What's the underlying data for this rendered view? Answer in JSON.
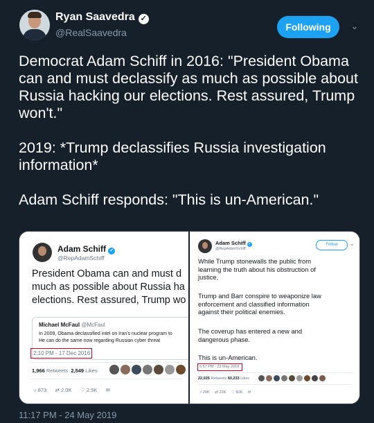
{
  "tweet": {
    "author_name": "Ryan Saavedra",
    "author_handle": "@RealSaavedra",
    "verified_glyph": "✓",
    "follow_label": "Following",
    "caret_glyph": "⌄",
    "paragraphs": [
      "Democrat Adam Schiff in 2016: \"President Obama can and must declassify as much as possible about Russia hacking our elections. Rest assured, Trump won't.\"",
      "2019: *Trump declassifies Russia investigation information*",
      "Adam Schiff responds: \"This is un-American.\""
    ],
    "timestamp": "11:17 PM - 24 May 2019"
  },
  "left_image": {
    "name": "Adam Schiff",
    "handle": "@RepAdamSchiff",
    "text_lines": [
      "President Obama can and must d",
      "much as possible about Russia ha",
      "elections. Rest assured, Trump wo"
    ],
    "quote_name": "Michael McFaul",
    "quote_handle": "@McFaul",
    "quote_lines": [
      "In 2009, Obama declassified intel on Iran's nuclear program  to",
      "He can do the same now regarding Russian cyber threat"
    ],
    "timestamp": "2:10 PM - 17 Dec 2016",
    "retweets": "1,966",
    "retweets_label": "Retweets",
    "likes": "2,549",
    "likes_label": "Likes",
    "actions": [
      "873",
      "2.0K",
      "2.5K"
    ]
  },
  "right_image": {
    "name": "Adam Schiff",
    "handle": "@RepAdamSchiff",
    "follow_label": "Follow",
    "caret_glyph": "⌄",
    "paragraphs": [
      [
        "While Trump stonewalls the public from",
        "learning the truth about his obstruction of",
        "justice,"
      ],
      [
        "Trump and Barr conspire to weaponize law",
        "enforcement and classified information",
        "against their political enemies."
      ],
      [
        "The coverup has entered a new and",
        "dangerous phase."
      ],
      [
        "This is un-American."
      ]
    ],
    "timestamp": "6:57 PM - 23 May 2019",
    "retweets": "22,025",
    "retweets_label": "Retweets",
    "likes": "60,233",
    "likes_label": "Likes",
    "actions": [
      "29K",
      "22K",
      "60K"
    ]
  },
  "colors": {
    "background": "#15202b",
    "accent": "#1da1f2",
    "highlight_box": "#d0021b"
  }
}
